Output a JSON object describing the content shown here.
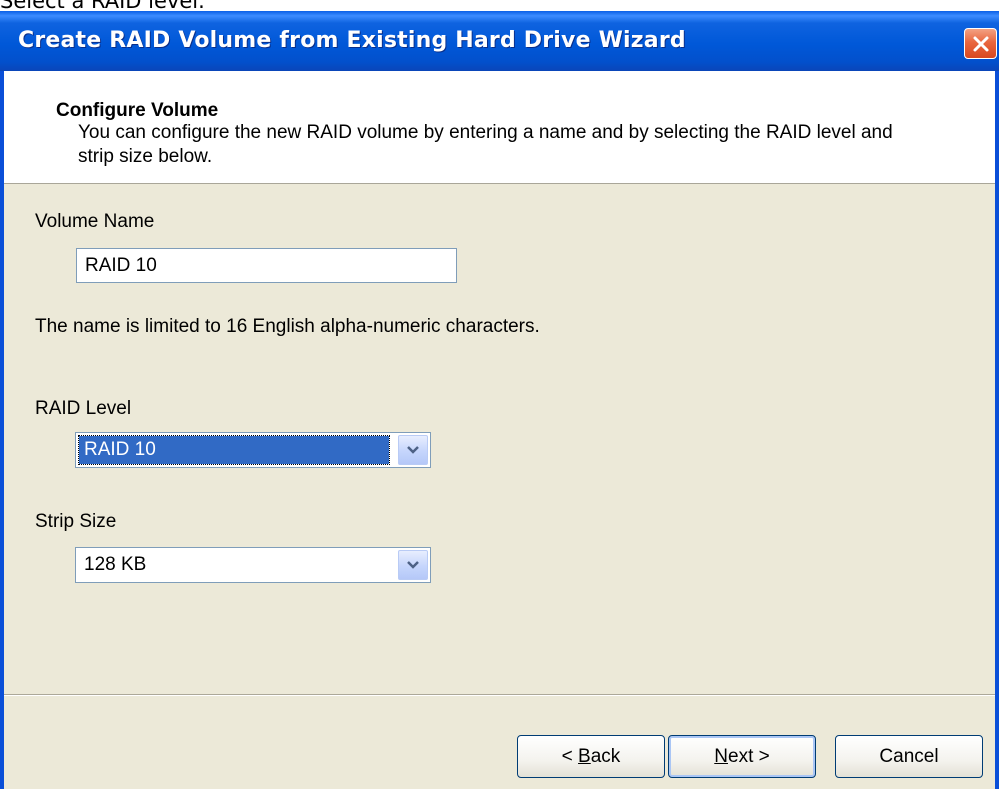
{
  "caption": "Select a RAID level.",
  "window": {
    "title": "Create RAID Volume from Existing Hard Drive Wizard"
  },
  "header": {
    "title": "Configure Volume",
    "description": "You can configure the new RAID volume by entering a name and by selecting the RAID level and strip size below."
  },
  "form": {
    "volume_name_label": "Volume Name",
    "volume_name_value": "RAID 10",
    "volume_name_hint": "The name is limited to 16 English alpha-numeric characters.",
    "raid_level_label": "RAID Level",
    "raid_level_value": "RAID 10",
    "strip_size_label": "Strip Size",
    "strip_size_value": "128 KB"
  },
  "buttons": {
    "back": {
      "underline": "B",
      "rest": "ack",
      "prefix": "< "
    },
    "next": {
      "underline": "N",
      "rest": "ext >",
      "prefix": ""
    },
    "cancel": "Cancel"
  },
  "colors": {
    "titlebar": "#0058d8",
    "selection": "#316ac5",
    "dialog_bg": "#ece9d8",
    "close_button": "#e9673f"
  },
  "icons": {
    "close": "close-icon",
    "dropdown": "chevron-down-icon"
  }
}
